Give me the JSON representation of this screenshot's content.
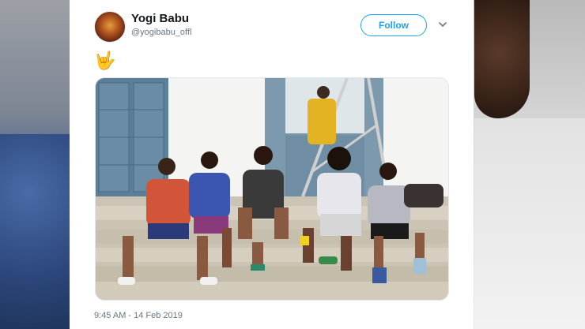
{
  "tweet": {
    "author": {
      "name": "Yogi Babu",
      "handle": "@yogibabu_offl"
    },
    "follow_label": "Follow",
    "text_emoji": "🤟",
    "timestamp": "9:45 AM - 14 Feb 2019"
  },
  "colors": {
    "accent": "#1da1f2",
    "text_primary": "#14171a",
    "text_secondary": "#657786"
  },
  "icons": {
    "menu": "chevron-down-icon"
  }
}
